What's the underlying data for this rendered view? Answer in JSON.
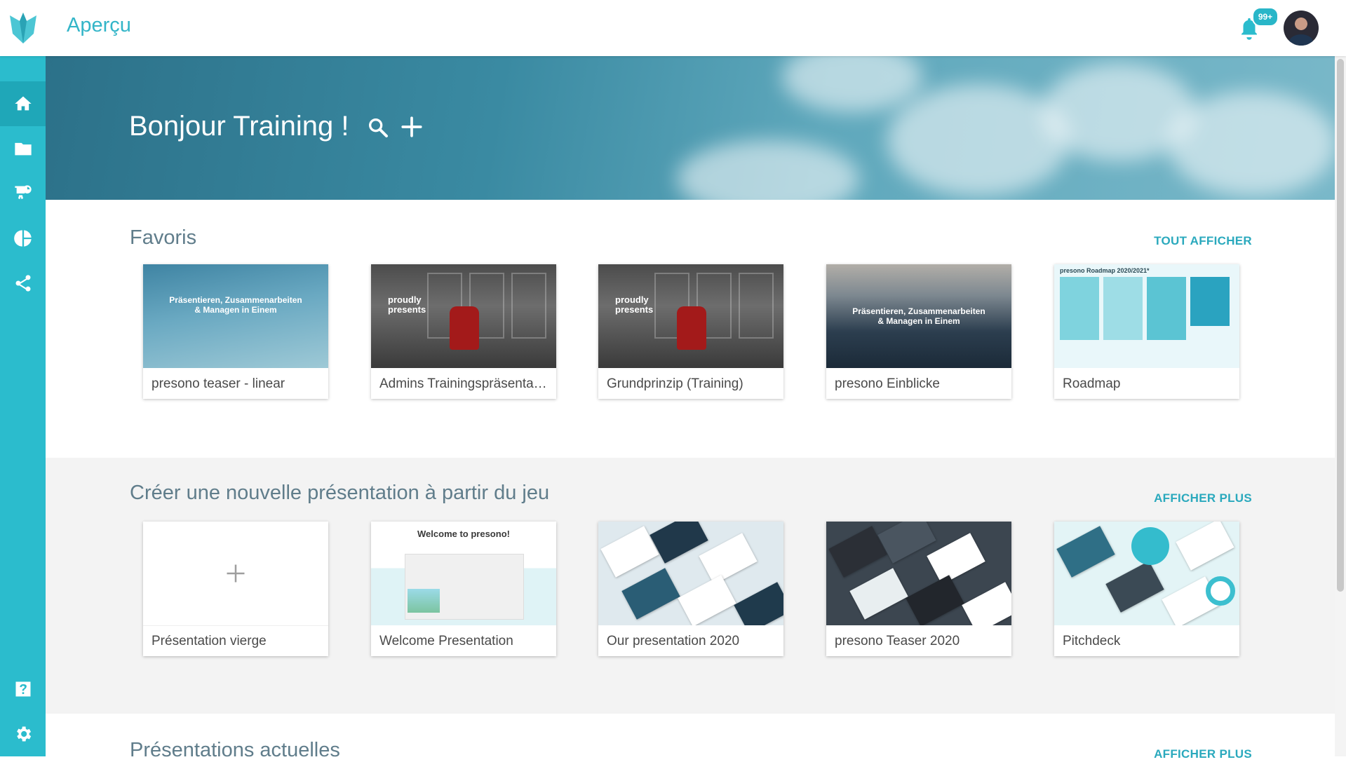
{
  "app": {
    "title": "Aperçu",
    "notification_count": "99+"
  },
  "hero": {
    "greeting": "Bonjour Training !"
  },
  "colors": {
    "accent": "#2bbccd",
    "link": "#2aa9bd",
    "sidebar_active": "#1fa7b8"
  },
  "sidebar": {
    "items": [
      {
        "icon": "home-icon"
      },
      {
        "icon": "folder-icon"
      },
      {
        "icon": "presentation-icon"
      },
      {
        "icon": "pie-chart-icon"
      },
      {
        "icon": "share-icon"
      },
      {
        "icon": "help-icon"
      },
      {
        "icon": "gear-icon"
      }
    ]
  },
  "favorites": {
    "title": "Favoris",
    "link": "TOUT AFFICHER",
    "cards": [
      {
        "label": "presono teaser - linear",
        "thumb_lines": [
          "Präsentieren, Zusammenarbeiten",
          "& Managen in Einem"
        ]
      },
      {
        "label": "Admins Trainingspräsentation",
        "thumb_lines": [
          "proudly",
          "presents"
        ]
      },
      {
        "label": "Grundprinzip (Training)",
        "thumb_lines": [
          "proudly",
          "presents"
        ]
      },
      {
        "label": "presono Einblicke",
        "thumb_lines": [
          "Präsentieren, Zusammenarbeiten",
          "& Managen in Einem"
        ]
      },
      {
        "label": "Roadmap",
        "thumb_lines": [
          "presono Roadmap 2020/2021*"
        ]
      }
    ]
  },
  "new_from_set": {
    "title": "Créer une nouvelle présentation à partir du jeu",
    "link": "AFFICHER PLUS",
    "cards": [
      {
        "label": "Présentation vierge"
      },
      {
        "label": "Welcome Presentation",
        "thumb_title": "Welcome to presono!"
      },
      {
        "label": "Our presentation 2020"
      },
      {
        "label": "presono Teaser 2020"
      },
      {
        "label": "Pitchdeck"
      }
    ]
  },
  "current": {
    "title": "Présentations actuelles",
    "link": "AFFICHER PLUS"
  }
}
